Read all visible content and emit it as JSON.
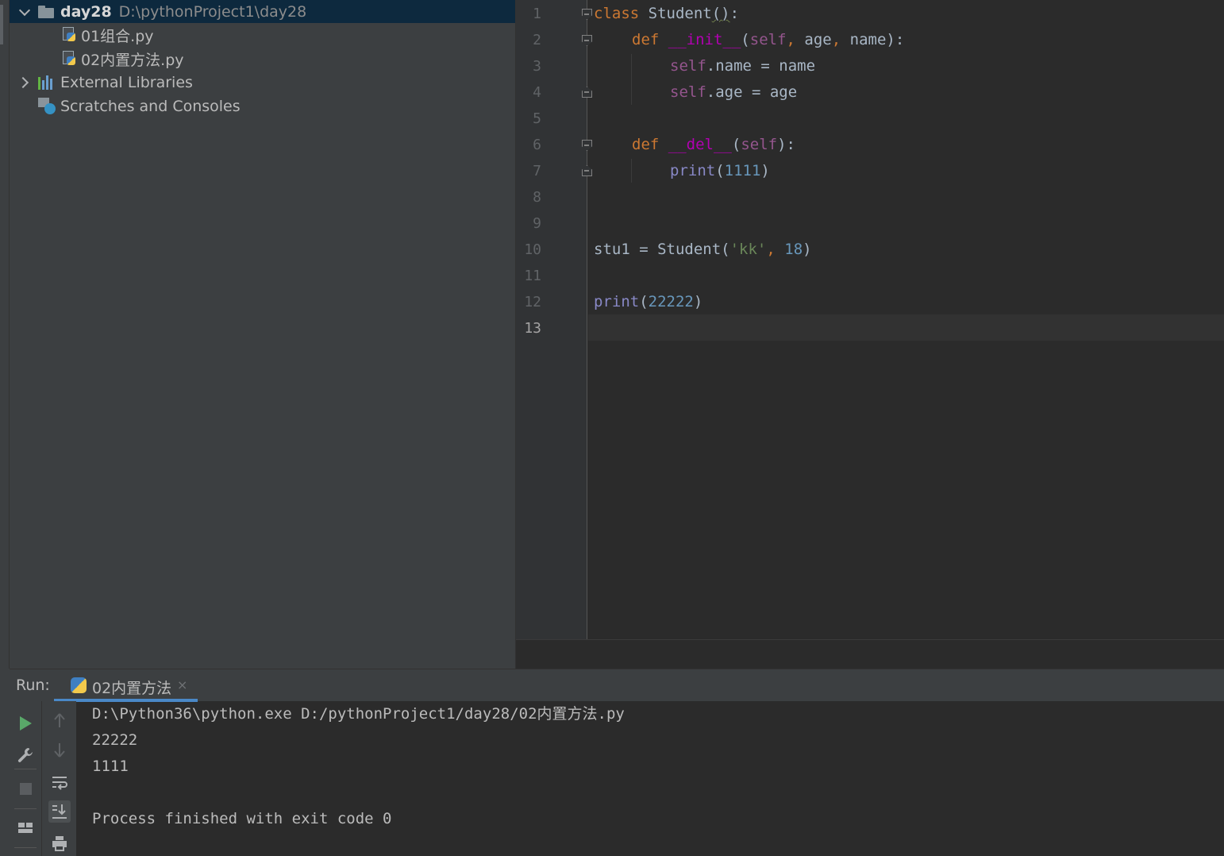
{
  "project_tree": {
    "root": {
      "name": "day28",
      "path": "D:\\pythonProject1\\day28"
    },
    "files": [
      {
        "name": "01组合.py"
      },
      {
        "name": "02内置方法.py"
      }
    ],
    "external_libraries": "External Libraries",
    "scratches": "Scratches and Consoles"
  },
  "editor": {
    "line_numbers": [
      "1",
      "2",
      "3",
      "4",
      "5",
      "6",
      "7",
      "8",
      "9",
      "10",
      "11",
      "12",
      "13"
    ],
    "current_line": 13,
    "code": {
      "l1": {
        "kw": "class",
        "rest": " Student",
        "squig": "()",
        "end": ":"
      },
      "l2": {
        "kw": "def",
        "magic": "__init__",
        "p1": "(",
        "self": "self",
        "comma1": ",",
        "age": " age",
        "comma2": ",",
        "name": " name",
        "end": "):"
      },
      "l3": {
        "self": "self",
        "rest": ".name = name"
      },
      "l4": {
        "self": "self",
        "rest": ".age = age"
      },
      "l6": {
        "kw": "def",
        "magic": "__del__",
        "p1": "(",
        "self": "self",
        "end": "):"
      },
      "l7": {
        "builtin": "print",
        "p1": "(",
        "num": "1111",
        "end": ")"
      },
      "l10": {
        "rest": "stu1 = Student(",
        "str": "'kk'",
        "comma": ",",
        "num": " 18",
        "end": ")"
      },
      "l12": {
        "builtin": "print",
        "p1": "(",
        "num": "22222",
        "end": ")"
      }
    }
  },
  "run_panel": {
    "label": "Run:",
    "tab_label": "02内置方法",
    "close": "×",
    "output": [
      "D:\\Python36\\python.exe D:/pythonProject1/day28/02内置方法.py",
      "22222",
      "1111",
      "",
      "Process finished with exit code 0"
    ]
  },
  "colors": {
    "keyword": "#cc7832",
    "magic_method": "#b200b2",
    "self": "#94558d",
    "number": "#6897bb",
    "string": "#6a8759",
    "builtin": "#8888c6",
    "accent": "#4a88c7",
    "run_green": "#59a869"
  }
}
